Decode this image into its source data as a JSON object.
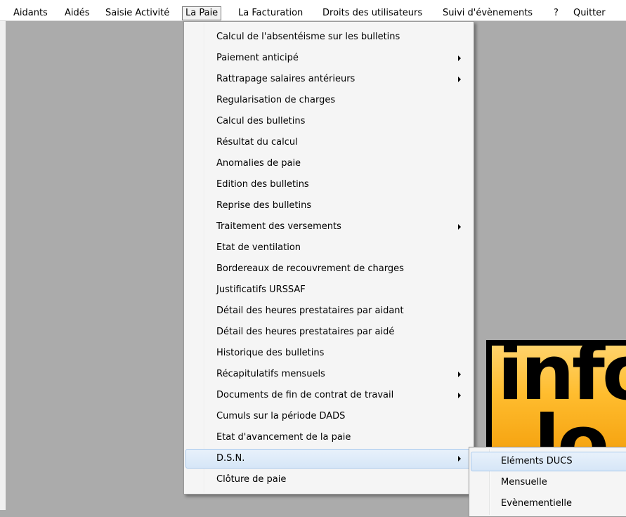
{
  "menubar": {
    "items": [
      {
        "label": "Aidants"
      },
      {
        "label": "Aidés"
      },
      {
        "label": "Saisie Activité"
      },
      {
        "label": "La Paie"
      },
      {
        "label": "La Facturation"
      },
      {
        "label": "Droits des utilisateurs"
      },
      {
        "label": "Suivi d'évènements"
      },
      {
        "label": "?"
      },
      {
        "label": "Quitter"
      }
    ],
    "active": "La Paie"
  },
  "dropdown": {
    "items": [
      {
        "label": "Calcul de l'absentéisme sur les bulletins",
        "submenu": false
      },
      {
        "label": "Paiement anticipé",
        "submenu": true
      },
      {
        "label": "Rattrapage salaires antérieurs",
        "submenu": true
      },
      {
        "label": "Regularisation de charges",
        "submenu": false
      },
      {
        "label": "Calcul des bulletins",
        "submenu": false
      },
      {
        "label": "Résultat du calcul",
        "submenu": false
      },
      {
        "label": "Anomalies de paie",
        "submenu": false
      },
      {
        "label": "Edition des bulletins",
        "submenu": false
      },
      {
        "label": "Reprise des bulletins",
        "submenu": false
      },
      {
        "label": "Traitement des versements",
        "submenu": true
      },
      {
        "label": "Etat de ventilation",
        "submenu": false
      },
      {
        "label": "Bordereaux de recouvrement de charges",
        "submenu": false
      },
      {
        "label": "Justificatifs URSSAF",
        "submenu": false
      },
      {
        "label": "Détail des heures prestataires par aidant",
        "submenu": false
      },
      {
        "label": "Détail des heures prestataires par aidé",
        "submenu": false
      },
      {
        "label": "Historique des bulletins",
        "submenu": false
      },
      {
        "label": "Récapitulatifs mensuels",
        "submenu": true
      },
      {
        "label": "Documents de fin de contrat de travail",
        "submenu": true
      },
      {
        "label": "Cumuls sur la période DADS",
        "submenu": false
      },
      {
        "label": "Etat d'avancement de la paie",
        "submenu": false
      },
      {
        "label": "D.S.N.",
        "submenu": true
      },
      {
        "label": "Clôture de paie",
        "submenu": false
      }
    ],
    "highlighted": "D.S.N."
  },
  "submenu": {
    "items": [
      {
        "label": "Eléments DUCS"
      },
      {
        "label": "Mensuelle"
      },
      {
        "label": "Evènementielle"
      }
    ],
    "highlighted": "Eléments DUCS"
  },
  "logo": {
    "text": "info",
    "text_line2": "lo"
  },
  "colors": {
    "desktop": "#ababab",
    "menu_bg": "#f5f5f5",
    "highlight": "#d6e6f7",
    "logo_orange": "#ffbd2f"
  }
}
